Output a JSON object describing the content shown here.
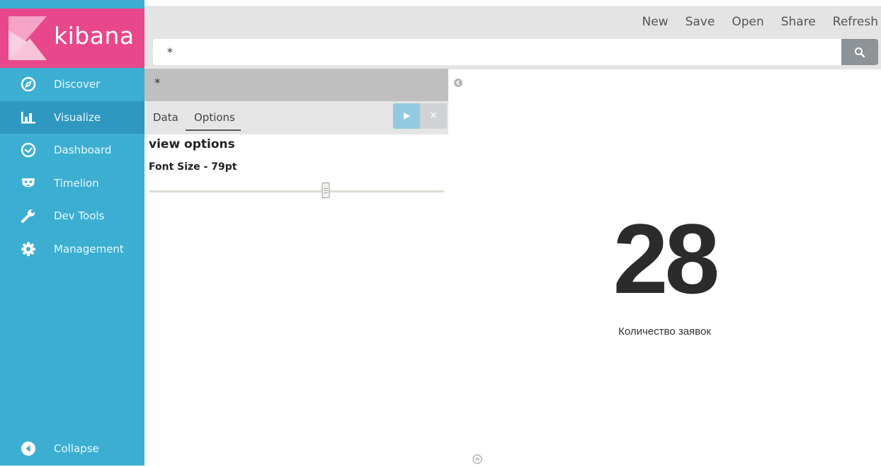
{
  "app": {
    "name": "kibana"
  },
  "sidebar": {
    "items": [
      {
        "label": "Discover",
        "icon": "compass-icon",
        "active": false
      },
      {
        "label": "Visualize",
        "icon": "bar-chart-icon",
        "active": true
      },
      {
        "label": "Dashboard",
        "icon": "dashboard-gauge-icon",
        "active": false
      },
      {
        "label": "Timelion",
        "icon": "timelion-mask-icon",
        "active": false
      },
      {
        "label": "Dev Tools",
        "icon": "wrench-icon",
        "active": false
      },
      {
        "label": "Management",
        "icon": "gear-icon",
        "active": false
      }
    ],
    "collapse_label": "Collapse"
  },
  "top_menu": {
    "new": "New",
    "save": "Save",
    "open": "Open",
    "share": "Share",
    "refresh": "Refresh"
  },
  "search": {
    "query": "*",
    "button_icon": "search-icon"
  },
  "editor": {
    "title": "*",
    "tabs": {
      "data": "Data",
      "options": "Options",
      "active": "Options"
    },
    "options_heading": "view options",
    "font_size_label": "Font Size - 79pt",
    "font_size_slider_fraction": 0.6
  },
  "visualization": {
    "metric_value": "28",
    "metric_label": "Количество заявок"
  },
  "colors": {
    "sidebar": "#3caed2",
    "sidebar_active": "#2e98c0",
    "logo_bg": "#e8488b",
    "apply_button": "#92cbe0"
  }
}
